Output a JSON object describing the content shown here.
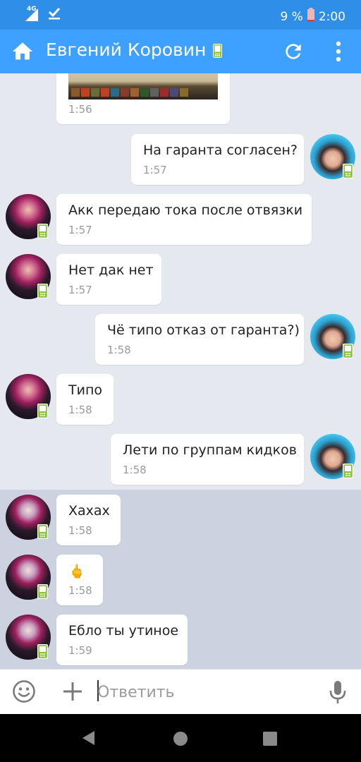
{
  "status": {
    "network": "4G",
    "battery": "9 %",
    "time": "2:00"
  },
  "header": {
    "title": "Евгений Коровин"
  },
  "messages": [
    {
      "side": "in",
      "text": "",
      "time": "1:56",
      "has_image": true
    },
    {
      "side": "out",
      "text": "На гаранта согласен?",
      "time": "1:57"
    },
    {
      "side": "in",
      "text": "Акк передаю тока после отвязки",
      "time": "1:57"
    },
    {
      "side": "in",
      "text": "Нет дак нет",
      "time": "1:57"
    },
    {
      "side": "out",
      "text": "Чё типо отказ от гаранта?)",
      "time": "1:58"
    },
    {
      "side": "in",
      "text": "Типо",
      "time": "1:58"
    },
    {
      "side": "out",
      "text": "Лети по группам кидков",
      "time": "1:58"
    },
    {
      "side": "in",
      "text": "Хахах",
      "time": "1:58"
    },
    {
      "side": "in",
      "text": "🖕",
      "time": "1:58"
    },
    {
      "side": "in",
      "text": "Ебло ты утиное",
      "time": "1:59"
    }
  ],
  "input": {
    "placeholder": "Ответить"
  },
  "colors": {
    "status_bar": "#2f8fe8",
    "app_bar": "#3ea0ff",
    "chat_bg": "#e5e8ee",
    "unread_bg": "#ccd2df",
    "online_badge": "#8ac33c"
  },
  "icons": {
    "home": "home-icon",
    "online": "mobile-online-icon",
    "refresh": "refresh-icon",
    "menu": "more-vertical-icon",
    "emoji": "emoji-icon",
    "attach": "plus-icon",
    "voice": "microphone-icon"
  }
}
